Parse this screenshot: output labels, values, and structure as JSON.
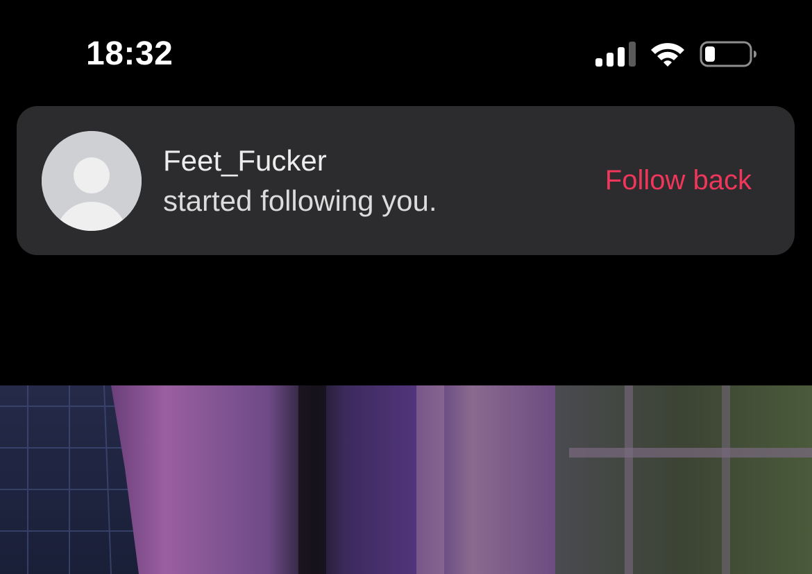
{
  "status_bar": {
    "time": "18:32",
    "icons": [
      "cellular-signal-icon",
      "wifi-icon",
      "battery-low-icon"
    ]
  },
  "notification": {
    "username": "Feet_Fucker",
    "message": "started following you.",
    "action_label": "Follow back",
    "avatar": "default-profile-avatar",
    "colors": {
      "card_background": "#2c2c2e",
      "action": "#f0365a"
    }
  }
}
